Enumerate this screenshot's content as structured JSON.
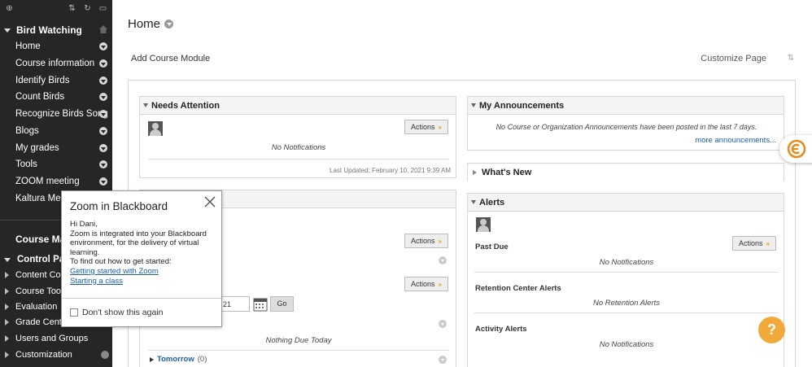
{
  "sidebar": {
    "course_title": "Bird Watching",
    "items": [
      {
        "label": "Home"
      },
      {
        "label": "Course information"
      },
      {
        "label": "Identify Birds"
      },
      {
        "label": "Count Birds"
      },
      {
        "label": "Recognize Birds Song"
      },
      {
        "label": "Blogs"
      },
      {
        "label": "My grades"
      },
      {
        "label": "Tools"
      },
      {
        "label": "ZOOM meeting"
      },
      {
        "label": "Kaltura Media"
      }
    ],
    "management_heading": "Course Man",
    "control_panel": "Control Pane",
    "tools": [
      {
        "label": "Content Collec"
      },
      {
        "label": "Course Tools"
      },
      {
        "label": "Evaluation"
      },
      {
        "label": "Grade Center"
      },
      {
        "label": "Users and Groups"
      },
      {
        "label": "Customization"
      }
    ]
  },
  "main": {
    "title": "Home",
    "add_module": "Add Course Module",
    "customize": "Customize Page"
  },
  "needs_attention": {
    "title": "Needs Attention",
    "actions": "Actions",
    "empty": "No Notifications",
    "updated": "Last Updated: February 10, 2021 9:39 AM"
  },
  "todo": {
    "actions_1": "Actions",
    "actions_2": "Actions",
    "date_tail": "21",
    "go": "Go",
    "nothing_due": "Nothing Due Today",
    "tomorrow": "Tomorrow",
    "tomorrow_count": "(0)"
  },
  "announcements": {
    "title": "My Announcements",
    "empty": "No Course or Organization Announcements have been posted in the last 7 days.",
    "more": "more announcements..."
  },
  "whats_new": {
    "title": "What's New"
  },
  "alerts": {
    "title": "Alerts",
    "actions": "Actions",
    "past_due": "Past Due",
    "past_due_empty": "No Notifications",
    "retention": "Retention Center Alerts",
    "retention_empty": "No Retention Alerts",
    "activity": "Activity Alerts",
    "activity_empty": "No Notifications"
  },
  "popup": {
    "title": "Zoom in Blackboard",
    "greeting": "Hi Dani,",
    "body": "Zoom is integrated into your Blackboard environment, for the delivery of virtual learning.",
    "find_out": "To find out how to get started:",
    "link_1": "Getting started with Zoom",
    "link_2": "Starting a class",
    "dont_show": "Don't show this again"
  },
  "help": {
    "glyph": "?"
  },
  "colors": {
    "accent": "#f2a93b",
    "sidebar": "#262626",
    "link": "#1a5ea8"
  }
}
